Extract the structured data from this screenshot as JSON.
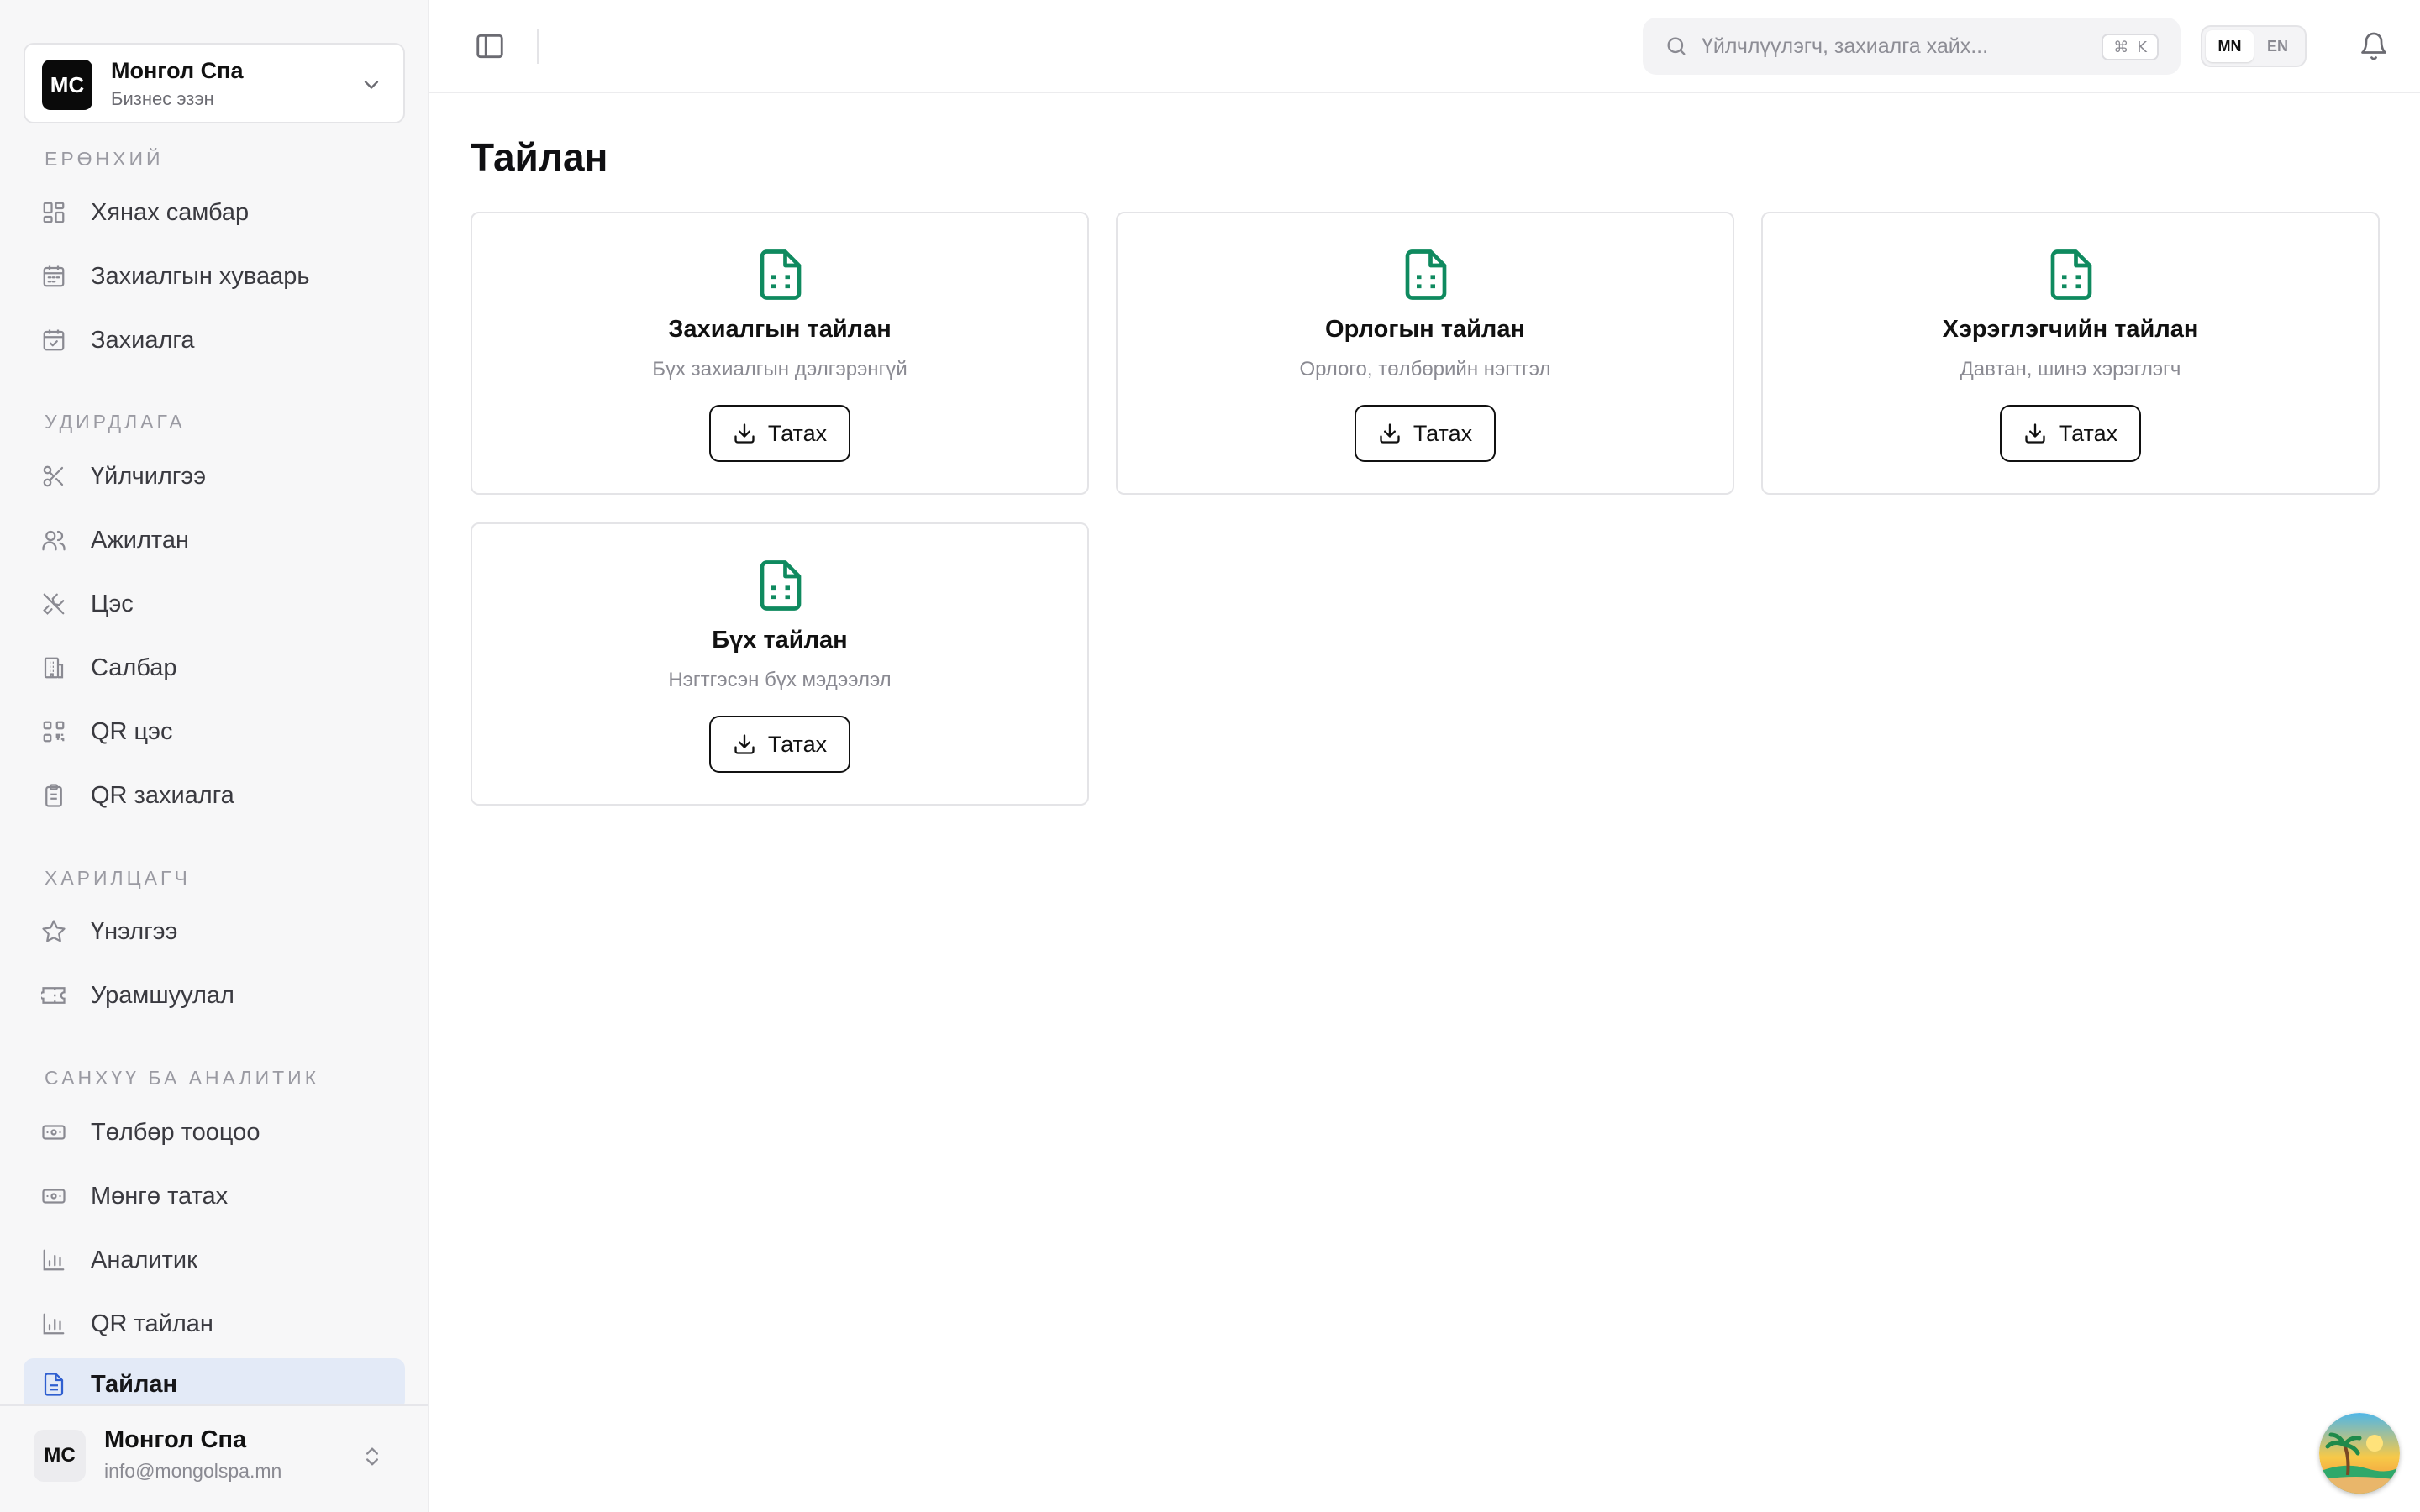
{
  "business": {
    "initials": "MC",
    "name": "Монгол Спа",
    "role": "Бизнес эзэн"
  },
  "sections": [
    {
      "label": "ЕРӨНХИЙ",
      "items": [
        {
          "label": "Хянах самбар",
          "icon": "dashboard-icon"
        },
        {
          "label": "Захиалгын хуваарь",
          "icon": "calendar-icon"
        },
        {
          "label": "Захиалга",
          "icon": "calendar-check-icon"
        }
      ]
    },
    {
      "label": "УДИРДЛАГА",
      "items": [
        {
          "label": "Үйлчилгээ",
          "icon": "scissors-icon"
        },
        {
          "label": "Ажилтан",
          "icon": "users-icon"
        },
        {
          "label": "Цэс",
          "icon": "utensils-icon"
        },
        {
          "label": "Салбар",
          "icon": "building-icon"
        },
        {
          "label": "QR цэс",
          "icon": "qr-code-icon"
        },
        {
          "label": "QR захиалга",
          "icon": "clipboard-icon"
        }
      ]
    },
    {
      "label": "ХАРИЛЦАГЧ",
      "items": [
        {
          "label": "Үнэлгээ",
          "icon": "star-icon"
        },
        {
          "label": "Урамшуулал",
          "icon": "ticket-icon"
        }
      ]
    },
    {
      "label": "САНХҮҮ БА АНАЛИТИК",
      "items": [
        {
          "label": "Төлбөр тооцоо",
          "icon": "banknote-icon"
        },
        {
          "label": "Мөнгө татах",
          "icon": "banknote-icon"
        },
        {
          "label": "Аналитик",
          "icon": "bar-chart-icon"
        },
        {
          "label": "QR тайлан",
          "icon": "bar-chart-icon"
        },
        {
          "label": "Тайлан",
          "icon": "file-text-icon",
          "active": true
        }
      ]
    }
  ],
  "user": {
    "initials": "MC",
    "name": "Монгол Спа",
    "email": "info@mongolspa.mn"
  },
  "search": {
    "placeholder": "Үйлчлүүлэгч, захиалга хайх...",
    "shortcut_mod": "⌘",
    "shortcut_key": "K"
  },
  "language": {
    "options": [
      "MN",
      "EN"
    ],
    "selected": "MN"
  },
  "page": {
    "title": "Тайлан"
  },
  "reports": [
    {
      "title": "Захиалгын тайлан",
      "description": "Бүх захиалгын дэлгэрэнгүй",
      "button": "Татах"
    },
    {
      "title": "Орлогын тайлан",
      "description": "Орлого, төлбөрийн нэгтгэл",
      "button": "Татах"
    },
    {
      "title": "Хэрэглэгчийн тайлан",
      "description": "Давтан, шинэ хэрэглэгч",
      "button": "Татах"
    },
    {
      "title": "Бүх тайлан",
      "description": "Нэгтгэсэн бүх мэдээлэл",
      "button": "Татах"
    }
  ],
  "colors": {
    "accent": "#0f8a5f",
    "active_bg": "#e3eaf7",
    "sidebar_bg": "#f7f7f8"
  }
}
